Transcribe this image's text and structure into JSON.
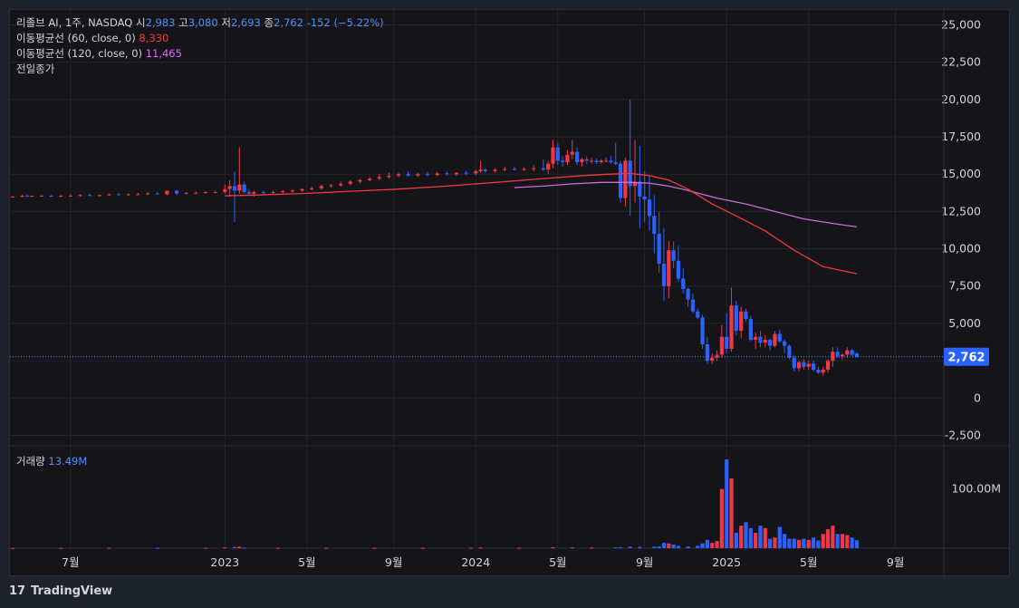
{
  "header": {
    "symbol": "리졸브 AI, 1주, NASDAQ",
    "open_label": "시",
    "open": "2,983",
    "high_label": "고",
    "high": "3,080",
    "low_label": "저",
    "low": "2,693",
    "close_label": "종",
    "close": "2,762",
    "change": "-152 (−5.22%)"
  },
  "indicators": [
    {
      "label": "이동평균선 (60, close, 0)",
      "value": "8,330",
      "color": "#f23645"
    },
    {
      "label": "이동평균선 (120, close, 0)",
      "value": "11,465",
      "color": "#e066ff"
    }
  ],
  "prev_close_label": "전일종가",
  "volume_legend": {
    "label": "거래량",
    "value": "13.49M"
  },
  "last_price_tag": "2,762",
  "brand": "TradingView",
  "colors": {
    "up": "#f23645",
    "down": "#2962ff",
    "ma60": "#f23645",
    "ma120": "#c86dd7",
    "background": "#141419"
  },
  "chart_data": {
    "type": "candlestick",
    "interval": "1주",
    "y_axis": {
      "ticks": [
        "25,000",
        "22,500",
        "20,000",
        "17,500",
        "15,000",
        "12,500",
        "10,000",
        "7,500",
        "5,000",
        "2,500",
        "0",
        "-2,500"
      ],
      "tick_values": [
        25000,
        22500,
        20000,
        17500,
        15000,
        12500,
        10000,
        7500,
        5000,
        2500,
        0,
        -2500
      ],
      "ylim": [
        -3200,
        26000
      ]
    },
    "volume_axis": {
      "ticks": [
        "100.00M"
      ],
      "tick_values": [
        100000000
      ],
      "ylim": [
        0,
        150000000
      ]
    },
    "x_axis": {
      "ticks": [
        "7월",
        "2023",
        "5월",
        "9월",
        "2024",
        "5월",
        "9월",
        "2025",
        "5월",
        "9월"
      ],
      "tick_weeks": [
        12,
        44,
        61,
        79,
        96,
        113,
        131,
        148,
        165,
        183
      ]
    },
    "week_range": [
      0,
      194
    ],
    "candles": [
      [
        0,
        13500,
        13550,
        13450,
        13500
      ],
      [
        2,
        13500,
        13600,
        13450,
        13550
      ],
      [
        3,
        13550,
        13650,
        13500,
        13500
      ],
      [
        4,
        13500,
        13550,
        13450,
        13550
      ],
      [
        6,
        13550,
        13600,
        13500,
        13550
      ],
      [
        8,
        13550,
        13600,
        13500,
        13500
      ],
      [
        10,
        13500,
        13600,
        13450,
        13550
      ],
      [
        12,
        13550,
        13650,
        13500,
        13550
      ],
      [
        14,
        13550,
        13650,
        13500,
        13600
      ],
      [
        16,
        13600,
        13700,
        13550,
        13550
      ],
      [
        18,
        13550,
        13650,
        13500,
        13600
      ],
      [
        20,
        13600,
        13700,
        13550,
        13650
      ],
      [
        22,
        13650,
        13750,
        13600,
        13600
      ],
      [
        24,
        13600,
        13700,
        13550,
        13650
      ],
      [
        26,
        13650,
        13750,
        13600,
        13650
      ],
      [
        28,
        13650,
        13800,
        13600,
        13700
      ],
      [
        30,
        13700,
        13800,
        13650,
        13650
      ],
      [
        32,
        13650,
        13800,
        13600,
        13900
      ],
      [
        34,
        13900,
        13950,
        13600,
        13700
      ],
      [
        36,
        13700,
        13800,
        13650,
        13750
      ],
      [
        38,
        13750,
        13850,
        13700,
        13750
      ],
      [
        40,
        13750,
        13850,
        13700,
        13800
      ],
      [
        42,
        13800,
        13900,
        13750,
        13800
      ],
      [
        44,
        13800,
        14300,
        13700,
        14000
      ],
      [
        45,
        14000,
        14600,
        13500,
        14200
      ],
      [
        46,
        14200,
        15200,
        11800,
        13900
      ],
      [
        47,
        13900,
        16800,
        13700,
        14300
      ],
      [
        48,
        14300,
        14500,
        13700,
        13800
      ],
      [
        49,
        13800,
        14000,
        13600,
        13700
      ],
      [
        50,
        13700,
        13900,
        13500,
        13800
      ],
      [
        52,
        13800,
        13900,
        13650,
        13750
      ],
      [
        54,
        13750,
        13900,
        13650,
        13800
      ],
      [
        56,
        13800,
        13950,
        13700,
        13850
      ],
      [
        58,
        13850,
        14000,
        13750,
        13900
      ],
      [
        60,
        13900,
        14050,
        13800,
        14000
      ],
      [
        62,
        14000,
        14150,
        13900,
        14050
      ],
      [
        64,
        14050,
        14300,
        13950,
        14200
      ],
      [
        66,
        14200,
        14350,
        14100,
        14250
      ],
      [
        68,
        14250,
        14500,
        14150,
        14350
      ],
      [
        70,
        14350,
        14600,
        14250,
        14500
      ],
      [
        72,
        14500,
        14700,
        14400,
        14600
      ],
      [
        74,
        14600,
        14800,
        14500,
        14700
      ],
      [
        76,
        14700,
        15000,
        14600,
        14800
      ],
      [
        78,
        14800,
        15100,
        14700,
        14900
      ],
      [
        80,
        14900,
        15100,
        14800,
        15000
      ],
      [
        82,
        15000,
        15200,
        14850,
        14900
      ],
      [
        84,
        14900,
        15100,
        14800,
        15000
      ],
      [
        86,
        15000,
        15150,
        14850,
        14950
      ],
      [
        88,
        14950,
        15150,
        14850,
        15050
      ],
      [
        90,
        15050,
        15200,
        14900,
        15000
      ],
      [
        92,
        15000,
        15150,
        14900,
        15100
      ],
      [
        94,
        15100,
        15250,
        14950,
        15050
      ],
      [
        96,
        15050,
        15300,
        14950,
        15200
      ],
      [
        97,
        15200,
        15900,
        15100,
        15300
      ],
      [
        98,
        15300,
        15400,
        15100,
        15200
      ],
      [
        100,
        15200,
        15400,
        15100,
        15300
      ],
      [
        102,
        15300,
        15500,
        15200,
        15350
      ],
      [
        104,
        15350,
        15500,
        15250,
        15300
      ],
      [
        106,
        15300,
        15450,
        15200,
        15350
      ],
      [
        108,
        15350,
        15600,
        15200,
        15400
      ],
      [
        110,
        15400,
        16000,
        15200,
        15300
      ],
      [
        111,
        15300,
        15900,
        15000,
        15700
      ],
      [
        112,
        15700,
        17300,
        15400,
        16800
      ],
      [
        113,
        16800,
        17100,
        15600,
        15900
      ],
      [
        114,
        15900,
        16200,
        15500,
        15800
      ],
      [
        115,
        15800,
        16600,
        15600,
        16300
      ],
      [
        116,
        16300,
        17300,
        16000,
        16500
      ],
      [
        117,
        16500,
        16800,
        15600,
        15800
      ],
      [
        118,
        15800,
        16100,
        15500,
        16000
      ],
      [
        119,
        16000,
        16200,
        15700,
        15900
      ],
      [
        120,
        15900,
        16100,
        15700,
        15900
      ],
      [
        121,
        15900,
        16050,
        15700,
        15800
      ],
      [
        122,
        15800,
        16000,
        15700,
        15900
      ],
      [
        123,
        15900,
        16100,
        15800,
        15900
      ],
      [
        124,
        15900,
        16200,
        15700,
        15800
      ],
      [
        125,
        15800,
        17100,
        15600,
        15700
      ],
      [
        126,
        15700,
        15900,
        13100,
        13400
      ],
      [
        127,
        13400,
        16100,
        12800,
        15900
      ],
      [
        128,
        15900,
        20000,
        12200,
        14200
      ],
      [
        129,
        14200,
        17300,
        13100,
        14500
      ],
      [
        130,
        14500,
        16900,
        11400,
        13500
      ],
      [
        131,
        13500,
        15200,
        11800,
        13300
      ],
      [
        132,
        13300,
        14900,
        11200,
        12200
      ],
      [
        133,
        12200,
        13600,
        9700,
        11000
      ],
      [
        134,
        11000,
        12500,
        8400,
        9000
      ],
      [
        135,
        9000,
        11400,
        6500,
        7500
      ],
      [
        136,
        7500,
        10500,
        6700,
        9900
      ],
      [
        137,
        9900,
        10500,
        8700,
        9200
      ],
      [
        138,
        9200,
        10200,
        7800,
        8000
      ],
      [
        139,
        8000,
        8700,
        7000,
        7300
      ],
      [
        140,
        7300,
        7400,
        6100,
        6600
      ],
      [
        141,
        6600,
        7000,
        5700,
        5800
      ],
      [
        142,
        5800,
        6000,
        5300,
        5400
      ],
      [
        143,
        5400,
        5600,
        3300,
        3600
      ],
      [
        144,
        3600,
        4100,
        2300,
        2500
      ],
      [
        145,
        2500,
        3000,
        2300,
        2700
      ],
      [
        146,
        2700,
        3200,
        2500,
        2900
      ],
      [
        147,
        2900,
        4900,
        2700,
        4100
      ],
      [
        148,
        4100,
        5700,
        3000,
        3300
      ],
      [
        149,
        3300,
        7400,
        3100,
        6200
      ],
      [
        150,
        6200,
        6500,
        4200,
        4500
      ],
      [
        151,
        4500,
        6100,
        4000,
        5800
      ],
      [
        152,
        5800,
        6000,
        5100,
        5300
      ],
      [
        153,
        5300,
        5500,
        3800,
        3900
      ],
      [
        154,
        3900,
        4400,
        3300,
        4100
      ],
      [
        155,
        4100,
        4500,
        3400,
        3700
      ],
      [
        156,
        3700,
        4200,
        3400,
        3900
      ],
      [
        157,
        3900,
        4000,
        3200,
        3500
      ],
      [
        158,
        3500,
        4500,
        3400,
        4300
      ],
      [
        159,
        4300,
        4600,
        3700,
        3800
      ],
      [
        160,
        3800,
        3900,
        3000,
        3500
      ],
      [
        161,
        3500,
        3600,
        2600,
        2700
      ],
      [
        162,
        2700,
        2900,
        1800,
        2000
      ],
      [
        163,
        2000,
        2500,
        1800,
        2400
      ],
      [
        164,
        2400,
        2600,
        1900,
        2100
      ],
      [
        165,
        2100,
        2500,
        1900,
        2300
      ],
      [
        166,
        2300,
        2500,
        1800,
        1900
      ],
      [
        167,
        1900,
        2100,
        1600,
        1700
      ],
      [
        168,
        1700,
        2100,
        1500,
        1900
      ],
      [
        169,
        1900,
        2600,
        1700,
        2500
      ],
      [
        170,
        2500,
        3400,
        2100,
        3100
      ],
      [
        171,
        3100,
        3400,
        2700,
        2800
      ],
      [
        172,
        2800,
        3000,
        2600,
        2900
      ],
      [
        173,
        2900,
        3400,
        2700,
        3200
      ],
      [
        174,
        3200,
        3300,
        2800,
        2900
      ],
      [
        175,
        2983,
        3080,
        2693,
        2762
      ]
    ],
    "volume": [
      [
        0,
        0.5
      ],
      [
        10,
        0.5
      ],
      [
        20,
        0.6
      ],
      [
        30,
        0.6
      ],
      [
        40,
        0.7
      ],
      [
        44,
        1.2
      ],
      [
        46,
        2.0
      ],
      [
        47,
        2.4
      ],
      [
        48,
        1.0
      ],
      [
        55,
        0.6
      ],
      [
        65,
        0.6
      ],
      [
        75,
        0.7
      ],
      [
        85,
        0.7
      ],
      [
        95,
        0.8
      ],
      [
        97,
        1.0
      ],
      [
        105,
        0.8
      ],
      [
        112,
        1.5
      ],
      [
        116,
        1.2
      ],
      [
        120,
        1.0
      ],
      [
        125,
        1.4
      ],
      [
        126,
        1.8
      ],
      [
        128,
        2.6
      ],
      [
        130,
        2.2
      ],
      [
        133,
        2.4
      ],
      [
        134,
        2.8
      ],
      [
        135,
        9.0
      ],
      [
        136,
        8.0
      ],
      [
        137,
        6.0
      ],
      [
        138,
        4.0
      ],
      [
        140,
        3.0
      ],
      [
        142,
        4.0
      ],
      [
        143,
        8.0
      ],
      [
        144,
        14.0
      ],
      [
        145,
        9.0
      ],
      [
        146,
        12.0
      ],
      [
        147,
        100.0
      ],
      [
        148,
        150.0
      ],
      [
        149,
        118.0
      ],
      [
        150,
        26.0
      ],
      [
        151,
        38.0
      ],
      [
        152,
        44.0
      ],
      [
        153,
        34.0
      ],
      [
        154,
        26.0
      ],
      [
        155,
        38.0
      ],
      [
        156,
        34.0
      ],
      [
        157,
        16.0
      ],
      [
        158,
        18.0
      ],
      [
        159,
        36.0
      ],
      [
        160,
        24.0
      ],
      [
        161,
        16.0
      ],
      [
        162,
        16.0
      ],
      [
        163,
        14.0
      ],
      [
        164,
        16.0
      ],
      [
        165,
        14.0
      ],
      [
        166,
        18.0
      ],
      [
        167,
        13.0
      ],
      [
        168,
        24.0
      ],
      [
        169,
        32.0
      ],
      [
        170,
        38.0
      ],
      [
        171,
        24.0
      ],
      [
        172,
        24.0
      ],
      [
        173,
        22.0
      ],
      [
        174,
        18.0
      ],
      [
        175,
        13.49
      ]
    ],
    "ma60": [
      [
        44,
        13550
      ],
      [
        50,
        13600
      ],
      [
        60,
        13700
      ],
      [
        70,
        13850
      ],
      [
        80,
        14000
      ],
      [
        90,
        14200
      ],
      [
        100,
        14450
      ],
      [
        110,
        14700
      ],
      [
        118,
        14900
      ],
      [
        124,
        15000
      ],
      [
        128,
        15050
      ],
      [
        132,
        14900
      ],
      [
        136,
        14600
      ],
      [
        140,
        14000
      ],
      [
        145,
        13000
      ],
      [
        150,
        12200
      ],
      [
        156,
        11200
      ],
      [
        162,
        9900
      ],
      [
        168,
        8800
      ],
      [
        175,
        8330
      ]
    ],
    "ma120": [
      [
        104,
        14100
      ],
      [
        110,
        14200
      ],
      [
        116,
        14350
      ],
      [
        122,
        14450
      ],
      [
        128,
        14450
      ],
      [
        132,
        14400
      ],
      [
        136,
        14200
      ],
      [
        140,
        13900
      ],
      [
        146,
        13400
      ],
      [
        152,
        13000
      ],
      [
        158,
        12500
      ],
      [
        164,
        12000
      ],
      [
        170,
        11700
      ],
      [
        175,
        11465
      ]
    ]
  }
}
